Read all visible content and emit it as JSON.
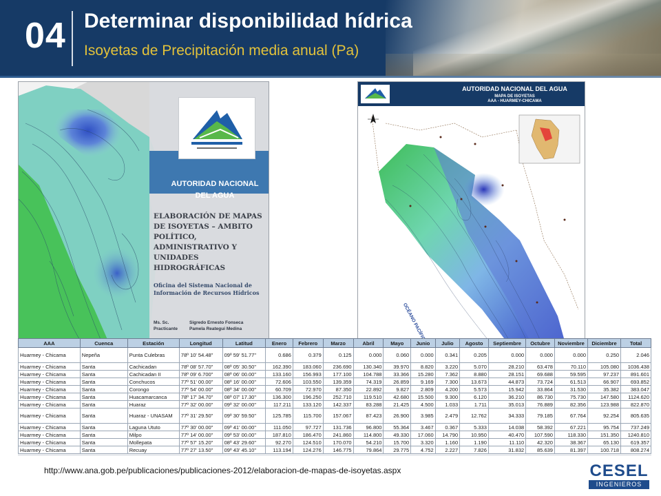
{
  "header": {
    "section_number": "04",
    "title": "Determinar disponibilidad hídrica",
    "subtitle": "Isoyetas de Precipitación media anual (Pa)"
  },
  "left_map": {
    "organization": "AUTORIDAD NACIONAL DEL AGUA",
    "title": "ELABORACIÓN DE MAPAS DE ISOYETAS – AMBITO POLÍTICO, ADMINISTRATIVO Y UNIDADES HIDROGRÁFICAS",
    "office": "Oficina del Sistema Nacional de Información de Recursos Hídricos",
    "credits": [
      {
        "role": "Ms. Sc.",
        "name": "Sigredo Ernesto Fonseca"
      },
      {
        "role": "Practicante",
        "name": "Pamela Reategui Medina"
      }
    ]
  },
  "right_map": {
    "banner_title": "AUTORIDAD NACIONAL DEL AGUA",
    "banner_sub1": "MAPA DE ISOYETAS",
    "banner_sub2": "AAA - HUARMEY-CHICAMA",
    "ocean_label": "OCÉANO PACÍFICO"
  },
  "table": {
    "headers": [
      "AAA",
      "Cuenca",
      "Estación",
      "Longitud",
      "Latitud",
      "Enero",
      "Febrero",
      "Marzo",
      "Abril",
      "Mayo",
      "Junio",
      "Julio",
      "Agosto",
      "Septiembre",
      "Octubre",
      "Noviembre",
      "Diciembre",
      "Total"
    ],
    "rows": [
      [
        "Huarmey - Chicama",
        "Nepeña",
        "Punta Culebras",
        "78º 10' 54.48\"",
        "09º 59' 51.77\"",
        "0.686",
        "0.379",
        "0.125",
        "0.000",
        "0.060",
        "0.000",
        "0.341",
        "0.205",
        "0.000",
        "0.000",
        "0.000",
        "0.250",
        "2.046"
      ],
      [
        "Huarmey - Chicama",
        "Santa",
        "Cachicadan",
        "78º 08' 57.70\"",
        "08º 05' 30.50\"",
        "162.390",
        "183.060",
        "236.690",
        "130.340",
        "39.970",
        "8.820",
        "3.220",
        "5.070",
        "28.210",
        "63.478",
        "70.110",
        "105.080",
        "1036.438"
      ],
      [
        "Huarmey - Chicama",
        "Santa",
        "Cachicadan II",
        "78º 09' 6.700\"",
        "08º 06' 00.00\"",
        "133.160",
        "156.993",
        "177.100",
        "104.788",
        "33.366",
        "15.280",
        "7.362",
        "8.880",
        "28.151",
        "69.688",
        "59.595",
        "97.237",
        "891.601"
      ],
      [
        "Huarmey - Chicama",
        "Santa",
        "Conchucos",
        "77º 51' 00.00\"",
        "08º 16' 00.00\"",
        "72.606",
        "103.550",
        "139.359",
        "74.319",
        "26.859",
        "9.169",
        "7.300",
        "13.673",
        "44.873",
        "73.724",
        "61.513",
        "66.907",
        "693.852"
      ],
      [
        "Huarmey - Chicama",
        "Santa",
        "Corongo",
        "77º 54' 00.00\"",
        "08º 34' 00.00\"",
        "60.709",
        "72.970",
        "87.350",
        "22.892",
        "9.827",
        "2.809",
        "4.200",
        "5.573",
        "15.942",
        "33.864",
        "31.530",
        "35.382",
        "383.047"
      ],
      [
        "Huarmey - Chicama",
        "Santa",
        "Huacamarcanca",
        "78º 17' 34.70\"",
        "08º 07' 17.30\"",
        "136.300",
        "196.250",
        "252.710",
        "119.510",
        "42.680",
        "15.500",
        "9.300",
        "6.120",
        "36.210",
        "86.730",
        "75.730",
        "147.580",
        "1124.620"
      ],
      [
        "Huarmey - Chicama",
        "Santa",
        "Huaraz",
        "77º 32' 00.00\"",
        "09º 32' 00.00\"",
        "117.211",
        "133.120",
        "142.337",
        "83.288",
        "21.425",
        "4.500",
        "1.033",
        "1.711",
        "35.013",
        "76.889",
        "82.356",
        "123.988",
        "822.870"
      ],
      [
        "Huarmey - Chicama",
        "Santa",
        "Huaraz - UNASAM",
        "77º 31' 29.50\"",
        "09º 30' 59.50\"",
        "125.785",
        "115.700",
        "157.067",
        "87.423",
        "26.900",
        "3.985",
        "2.479",
        "12.762",
        "34.333",
        "79.185",
        "67.764",
        "92.254",
        "805.635"
      ],
      [
        "Huarmey - Chicama",
        "Santa",
        "Laguna Ututo",
        "77º 30' 00.00\"",
        "09º 41' 00.00\"",
        "111.050",
        "97.727",
        "131.736",
        "96.800",
        "55.364",
        "3.467",
        "0.367",
        "5.333",
        "14.038",
        "58.392",
        "67.221",
        "95.754",
        "737.249"
      ],
      [
        "Huarmey - Chicama",
        "Santa",
        "Milpo",
        "77º 14' 00.00\"",
        "09º 53' 00.00\"",
        "187.810",
        "186.470",
        "241.860",
        "114.800",
        "49.330",
        "17.060",
        "14.790",
        "10.950",
        "40.470",
        "107.590",
        "118.330",
        "151.350",
        "1240.810"
      ],
      [
        "Huarmey - Chicama",
        "Santa",
        "Mollepata",
        "77º 57' 15.20\"",
        "08º 43' 29.60\"",
        "92.270",
        "124.510",
        "170.070",
        "54.210",
        "15.700",
        "3.320",
        "1.160",
        "1.190",
        "11.110",
        "42.320",
        "38.367",
        "65.130",
        "619.357"
      ],
      [
        "Huarmey - Chicama",
        "Santa",
        "Recuay",
        "77º 27' 13.50\"",
        "09º 43' 45.10\"",
        "113.194",
        "124.276",
        "146.775",
        "79.864",
        "29.775",
        "4.752",
        "2.227",
        "7.826",
        "31.832",
        "85.639",
        "81.397",
        "100.718",
        "808.274"
      ]
    ]
  },
  "footer": {
    "source_url": "http://www.ana.gob.pe/publicaciones/publicaciones-2012/elaboracion-de-mapas-de-isoyetas.aspx",
    "logo_main": "CESEL",
    "logo_sub": "INGENIEROS"
  }
}
